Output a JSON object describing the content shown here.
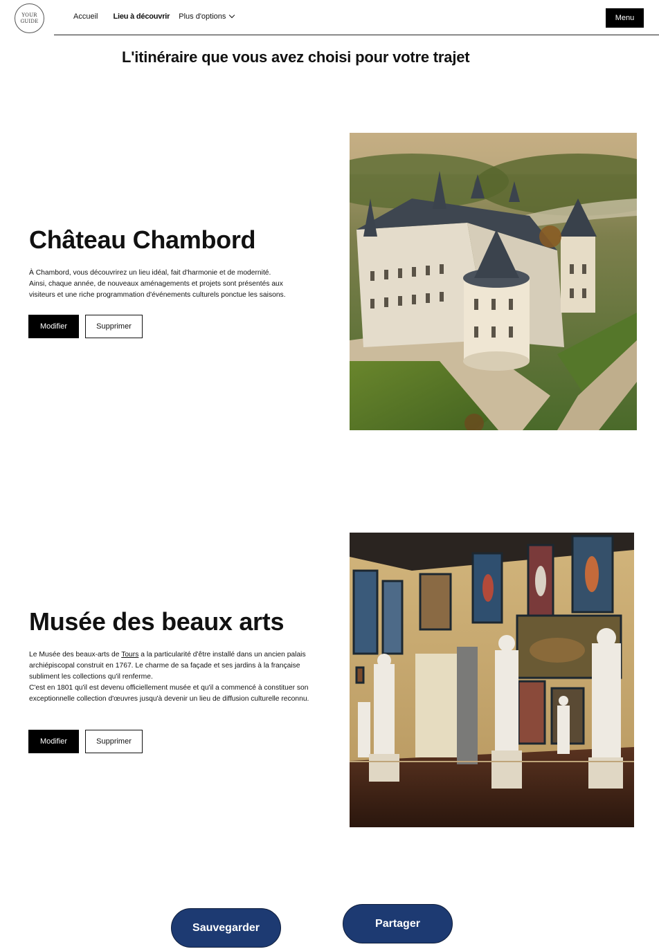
{
  "header": {
    "logo_lines": [
      "YOUR",
      "GUIDE"
    ],
    "nav": [
      {
        "label": "Accueil"
      },
      {
        "label": "Lieu à découvrir"
      },
      {
        "label": "Plus d'options"
      }
    ],
    "menu_label": "Menu"
  },
  "page_title": "L'itinéraire que vous avez choisi pour votre trajet",
  "places": [
    {
      "title": "Château Chambord",
      "description_lines": [
        "À Chambord, vous découvrirez un lieu idéal, fait d'harmonie et de modernité.",
        "Ainsi, chaque année, de nouveaux aménagements et projets sont présentés aux",
        "visiteurs et une riche programmation d'événements culturels ponctue les saisons."
      ],
      "edit_label": "Modifier",
      "delete_label": "Supprimer"
    },
    {
      "title": "Musée des beaux arts",
      "description": {
        "before_link": "Le Musée des beaux-arts de ",
        "link": "Tours",
        "after_link": " a la particularité d'être installé dans un ancien palais archiépiscopal construit en 1767. Le charme de sa façade et ses jardins à la française subliment les collections qu'il renferme.",
        "second_paragraph": "C'est en 1801 qu'il est devenu officiellement musée et qu'il a commencé à constituer son exceptionnelle collection d'œuvres jusqu'à devenir un lieu de diffusion culturelle reconnu."
      },
      "edit_label": "Modifier",
      "delete_label": "Supprimer"
    }
  ],
  "actions": {
    "save_label": "Sauvegarder",
    "share_label": "Partager"
  },
  "colors": {
    "accent": "#1d3a72",
    "dark": "#000000"
  }
}
